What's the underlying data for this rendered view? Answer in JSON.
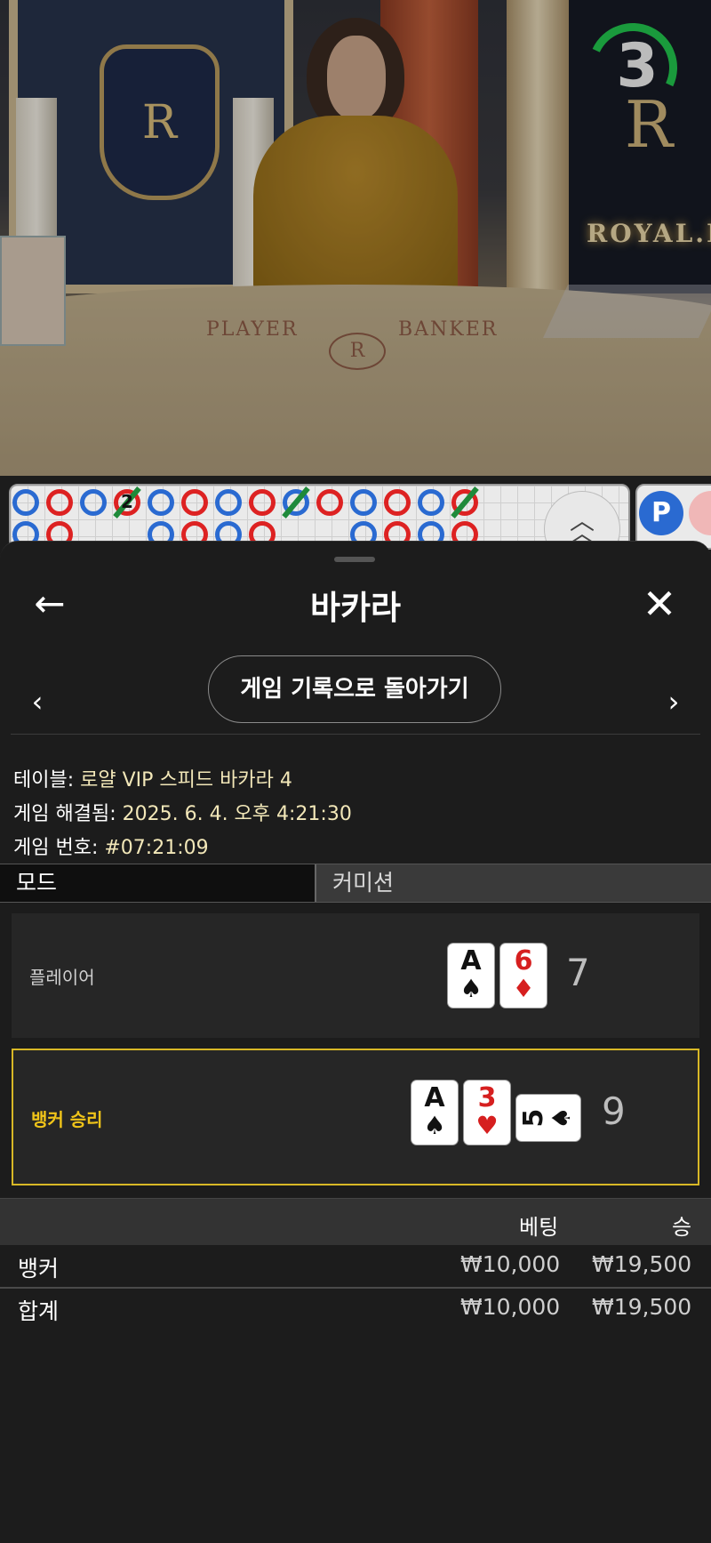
{
  "video": {
    "countdown": "3",
    "felt_player": "PLAYER",
    "felt_banker": "BANKER",
    "brand_text": "ROYAL.I",
    "logo_letter": "R"
  },
  "roadmap": {
    "tie_number": "2",
    "predict_label": "P"
  },
  "header": {
    "title": "바카라",
    "back_icon": "←",
    "close_icon": "✕"
  },
  "navigation": {
    "prev_icon": "‹",
    "next_icon": "›",
    "back_to_records": "게임 기록으로 돌아가기"
  },
  "info": {
    "table_label": "테이블:",
    "table_value": "로얄 VIP 스피드 바카라 4",
    "resolved_label": "게임 해결됨:",
    "resolved_value": "2025. 6. 4. 오후 4:21:30",
    "number_label": "게임 번호:",
    "number_value": "#07:21:09"
  },
  "mode": {
    "left": "모드",
    "right": "커미션"
  },
  "hands": {
    "player": {
      "label": "플레이어",
      "score": "7",
      "cards": [
        {
          "rank": "A",
          "suit": "♠",
          "color": "black"
        },
        {
          "rank": "6",
          "suit": "♦",
          "color": "red"
        }
      ]
    },
    "banker": {
      "label": "뱅커 승리",
      "score": "9",
      "cards": [
        {
          "rank": "A",
          "suit": "♠",
          "color": "black"
        },
        {
          "rank": "3",
          "suit": "♥",
          "color": "red"
        },
        {
          "rank": "5",
          "suit": "♠",
          "color": "black"
        }
      ]
    }
  },
  "bets": {
    "col_bet": "베팅",
    "col_win": "승",
    "rows": [
      {
        "label": "뱅커",
        "bet": "₩10,000",
        "win": "₩19,500"
      },
      {
        "label": "합계",
        "bet": "₩10,000",
        "win": "₩19,500"
      }
    ]
  },
  "colors": {
    "banker_highlight": "#d8b826",
    "banker_win_text": "#f0c419",
    "info_value": "#f2e7b8",
    "timer_arc": "#1a9a3c"
  }
}
